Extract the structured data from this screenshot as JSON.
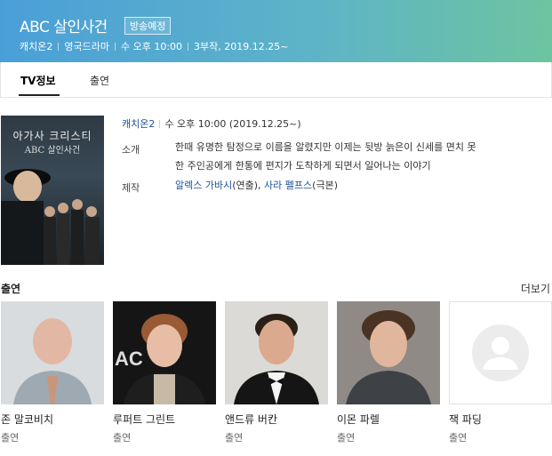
{
  "header": {
    "title": "ABC 살인사건",
    "badge": "방송예정",
    "meta": [
      "캐치온2",
      "영국드라마",
      "수 오후 10:00",
      "3부작, 2019.12.25~"
    ]
  },
  "tabs": [
    {
      "label": "TV정보",
      "active": true
    },
    {
      "label": "출연",
      "active": false
    }
  ],
  "poster": {
    "title_line1": "아가사 크리스티",
    "title_line2": "ABC 살인사건"
  },
  "info": {
    "channel": "캐치온2",
    "schedule": "수 오후 10:00 (2019.12.25~)",
    "intro_label": "소개",
    "intro_line1": "한때 유명한 탐정으로 이름을 알렸지만 이제는 뒷방 늙은이 신세를 면치 못",
    "intro_line2": "한 주인공에게 한통에 편지가 도착하게 되면서 일어나는 이야기",
    "prod_label": "제작",
    "director": "알렉스 가바시",
    "director_role": "(연출), ",
    "writer": "사라 펠프스",
    "writer_role": "(극본)"
  },
  "cast": {
    "heading": "출연",
    "more": "더보기",
    "members": [
      {
        "name": "존 말코비치",
        "role": "출연"
      },
      {
        "name": "루퍼트 그린트",
        "role": "출연"
      },
      {
        "name": "앤드류 버칸",
        "role": "출연"
      },
      {
        "name": "이몬 파렐",
        "role": "출연"
      },
      {
        "name": "잭 파딩",
        "role": "출연"
      }
    ]
  },
  "colors": {
    "header_start": "#4a9fd8",
    "header_end": "#6dc4a0",
    "link": "#1a4f9a"
  }
}
